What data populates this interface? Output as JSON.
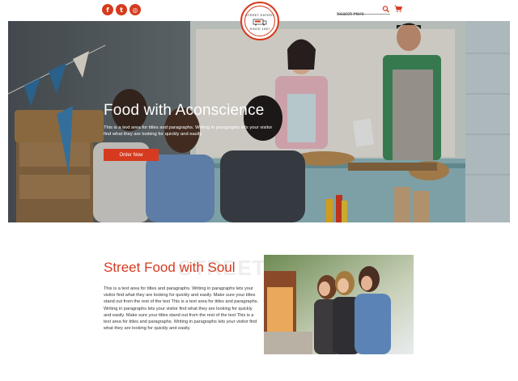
{
  "header": {
    "social": [
      {
        "icon": "facebook-icon",
        "glyph": "f"
      },
      {
        "icon": "twitter-icon",
        "glyph": "t"
      },
      {
        "icon": "instagram-icon",
        "glyph": "◎"
      }
    ],
    "logo": {
      "top_text": "STREET EATERY",
      "bottom_text": "SINCE 1987"
    },
    "search": {
      "placeholder": "Search Here"
    },
    "accent_color": "#d63b1f"
  },
  "hero": {
    "title": "Food with Aconscience",
    "text": "This is a text area for titles and paragraphs. Writing in paragraphs lets your visitor find what they are looking for quickly and easily.",
    "button_label": "Order Now"
  },
  "section": {
    "background_word": "STREET FOOD",
    "title": "Street Food with Soul",
    "text": "This is a text area for titles and paragraphs. Writing in paragraphs lets your visitor find what they are looking for quickly and easily. Make sure your titles stand out from the rest of the text This is a text area for titles and paragraphs. Writing in paragraphs lets your visitor find what they are looking for quickly and easily. Make sure your titles stand out from the rest of the text This is a text area for titles and paragraphs. Writing in paragraphs lets your visitor find what they are looking for quickly and easily."
  }
}
